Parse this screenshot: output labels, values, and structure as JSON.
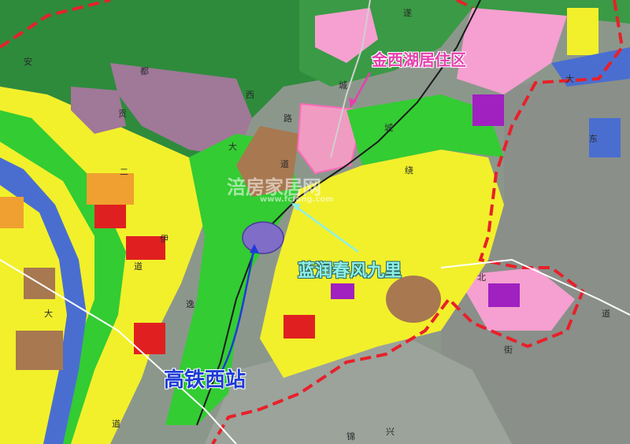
{
  "labels": {
    "jinxi": "金西湖居住区",
    "lanrun": "蓝润春风九里",
    "gaotie": "高铁西站"
  },
  "watermark": {
    "main": "涪房家居网",
    "url": "www.fcfang.com"
  },
  "road_chars": {
    "r1": "安",
    "r2": "都",
    "r3": "西",
    "r4": "路",
    "r5": "大",
    "r6": "道",
    "r7": "贡",
    "r8": "二",
    "r9": "伊",
    "r10": "道",
    "r11": "大",
    "r12": "逸",
    "r13": "道",
    "r14": "锦",
    "r15": "兴",
    "r16": "街",
    "r17": "遂",
    "r18": "城",
    "r19": "大",
    "r20": "东",
    "r21": "道",
    "r22": "绕",
    "r23": "城",
    "r24": "北"
  },
  "colors": {
    "forest": "#2e8b3c",
    "green": "#33cc33",
    "yellow": "#f2f02b",
    "orange": "#f0a030",
    "red": "#e02020",
    "pink": "#f5a0d0",
    "purple": "#a07898",
    "brown": "#a87850",
    "water": "#4a6ed0",
    "boundary": "#e8202a",
    "label_pink": "#e63fae",
    "label_cyan": "#8ff0e6",
    "label_blue": "#1f3bd6"
  }
}
